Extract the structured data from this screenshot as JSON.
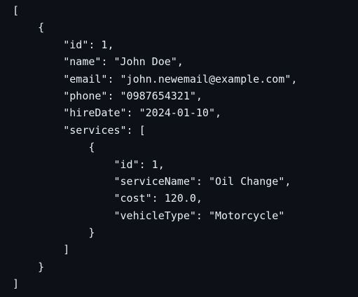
{
  "code_block": {
    "lines": [
      {
        "indent": "",
        "text": "["
      },
      {
        "indent": "    ",
        "text": "{"
      },
      {
        "indent": "        ",
        "text": "\"id\": 1,"
      },
      {
        "indent": "        ",
        "text": "\"name\": \"John Doe\","
      },
      {
        "indent": "        ",
        "text": "\"email\": \"john.newemail@example.com\","
      },
      {
        "indent": "        ",
        "text": "\"phone\": \"0987654321\","
      },
      {
        "indent": "        ",
        "text": "\"hireDate\": \"2024-01-10\","
      },
      {
        "indent": "        ",
        "text": "\"services\": ["
      },
      {
        "indent": "            ",
        "text": "{"
      },
      {
        "indent": "                ",
        "text": "\"id\": 1,"
      },
      {
        "indent": "                ",
        "text": "\"serviceName\": \"Oil Change\","
      },
      {
        "indent": "                ",
        "text": "\"cost\": 120.0,"
      },
      {
        "indent": "                ",
        "text": "\"vehicleType\": \"Motorcycle\""
      },
      {
        "indent": "            ",
        "text": "}"
      },
      {
        "indent": "        ",
        "text": "]"
      },
      {
        "indent": "    ",
        "text": "}"
      },
      {
        "indent": "",
        "text": "]"
      }
    ]
  },
  "colors": {
    "background": "#0d1117",
    "text": "#e6edf3"
  }
}
